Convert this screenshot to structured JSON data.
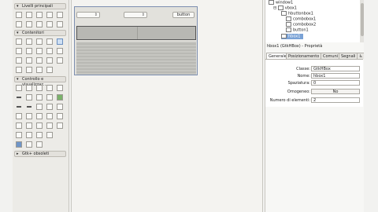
{
  "palette": {
    "sections": [
      {
        "label": "Livelli principali"
      },
      {
        "label": "Contenitori"
      },
      {
        "label": "Controllo e visualizzaz..."
      },
      {
        "label": "Gtk+ obsoleti"
      }
    ]
  },
  "canvas": {
    "button_label": "button"
  },
  "tree": {
    "nodes": [
      {
        "label": "window1"
      },
      {
        "label": "vbox1"
      },
      {
        "label": "hbuttonbox1"
      },
      {
        "label": "combobox1"
      },
      {
        "label": "combobox2"
      },
      {
        "label": "button1"
      },
      {
        "label": "hbox1"
      }
    ]
  },
  "properties": {
    "title": "hbox1 (GtkHBox) - Proprietà",
    "tabs": [
      {
        "label": "Generale"
      },
      {
        "label": "Posizionamento"
      },
      {
        "label": "Comuni"
      },
      {
        "label": "Segnali"
      },
      {
        "label": "♿"
      }
    ],
    "rows": [
      {
        "label": "Classe:",
        "value": "GtkHBox"
      },
      {
        "label": "Nome:",
        "value": "hbox1"
      },
      {
        "label": "Spaziatura:",
        "value": "0"
      },
      {
        "label": "Omogeneo:",
        "value": "No"
      },
      {
        "label": "Numero di elementi:",
        "value": "2"
      }
    ]
  }
}
